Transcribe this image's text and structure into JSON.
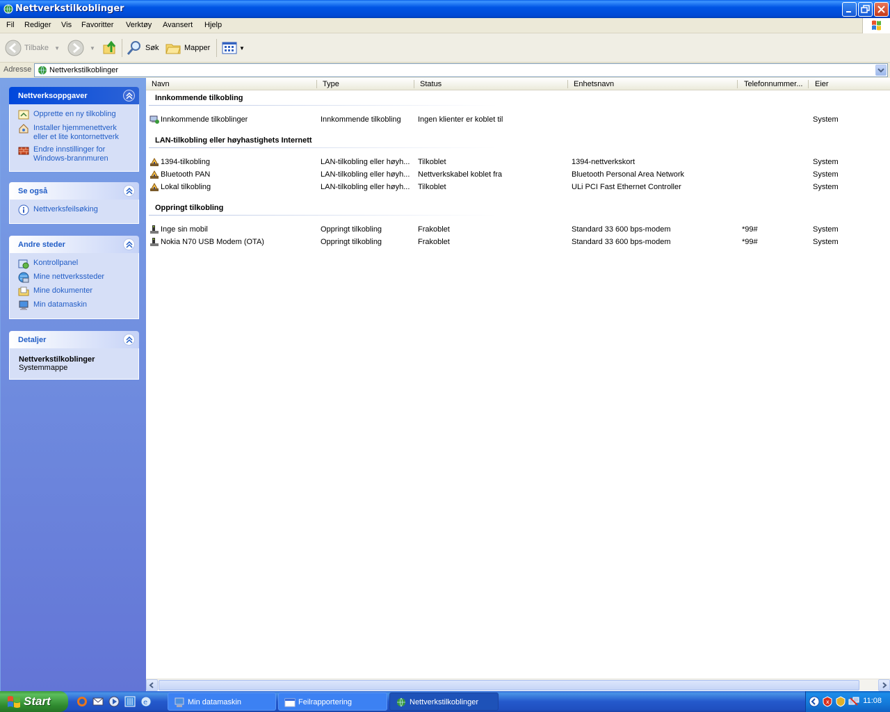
{
  "window": {
    "title": "Nettverkstilkoblinger"
  },
  "menu": [
    "Fil",
    "Rediger",
    "Vis",
    "Favoritter",
    "Verktøy",
    "Avansert",
    "Hjelp"
  ],
  "toolbar": {
    "back": "Tilbake",
    "search": "Søk",
    "folders": "Mapper"
  },
  "address": {
    "label": "Adresse",
    "value": "Nettverkstilkoblinger"
  },
  "sidebar": {
    "tasks": {
      "title": "Nettverksoppgaver",
      "items": [
        {
          "label": "Opprette en ny tilkobling",
          "icon": "new-connection-icon"
        },
        {
          "label": "Installer hjemmenettverk eller et lite kontornettverk",
          "icon": "home-network-icon"
        },
        {
          "label": "Endre innstillinger for Windows-brannmuren",
          "icon": "firewall-icon"
        }
      ]
    },
    "see_also": {
      "title": "Se også",
      "items": [
        {
          "label": "Nettverksfeilsøking",
          "icon": "info-icon"
        }
      ]
    },
    "other_places": {
      "title": "Andre steder",
      "items": [
        {
          "label": "Kontrollpanel",
          "icon": "control-panel-icon"
        },
        {
          "label": "Mine nettverkssteder",
          "icon": "network-places-icon"
        },
        {
          "label": "Mine dokumenter",
          "icon": "documents-folder-icon"
        },
        {
          "label": "Min datamaskin",
          "icon": "computer-icon"
        }
      ]
    },
    "details": {
      "title": "Detaljer",
      "name": "Nettverkstilkoblinger",
      "sub": "Systemmappe"
    }
  },
  "columns": [
    "Navn",
    "Type",
    "Status",
    "Enhetsnavn",
    "Telefonnummer...",
    "Eier"
  ],
  "groups": [
    {
      "title": "Innkommende tilkobling",
      "rows": [
        {
          "name": "Innkommende tilkoblinger",
          "type": "Innkommende tilkobling",
          "status": "Ingen klienter er koblet til",
          "device": "",
          "phone": "",
          "owner": "System",
          "icon": "incoming-connection-icon"
        }
      ]
    },
    {
      "title": "LAN-tilkobling eller høyhastighets Internett",
      "rows": [
        {
          "name": "1394-tilkobling",
          "type": "LAN-tilkobling eller høyh...",
          "status": "Tilkoblet",
          "device": "1394-nettverkskort",
          "phone": "",
          "owner": "System",
          "icon": "lan-connection-icon"
        },
        {
          "name": "Bluetooth PAN",
          "type": "LAN-tilkobling eller høyh...",
          "status": "Nettverkskabel koblet fra",
          "device": "Bluetooth Personal Area Network",
          "phone": "",
          "owner": "System",
          "icon": "lan-connection-icon"
        },
        {
          "name": "Lokal tilkobling",
          "type": "LAN-tilkobling eller høyh...",
          "status": "Tilkoblet",
          "device": "ULi PCI Fast Ethernet Controller",
          "phone": "",
          "owner": "System",
          "icon": "lan-connection-icon"
        }
      ]
    },
    {
      "title": "Oppringt tilkobling",
      "rows": [
        {
          "name": "Inge sin mobil",
          "type": "Oppringt tilkobling",
          "status": "Frakoblet",
          "device": "Standard 33 600 bps-modem",
          "phone": "*99#",
          "owner": "System",
          "icon": "dialup-connection-icon"
        },
        {
          "name": "Nokia N70 USB Modem (OTA)",
          "type": "Oppringt tilkobling",
          "status": "Frakoblet",
          "device": "Standard 33 600 bps-modem",
          "phone": "*99#",
          "owner": "System",
          "icon": "dialup-connection-icon"
        }
      ]
    }
  ],
  "taskbar": {
    "start": "Start",
    "tasks": [
      {
        "label": "Min datamaskin",
        "active": false
      },
      {
        "label": "Feilrapportering",
        "active": false
      },
      {
        "label": "Nettverkstilkoblinger",
        "active": true
      }
    ],
    "clock": "11:08"
  }
}
